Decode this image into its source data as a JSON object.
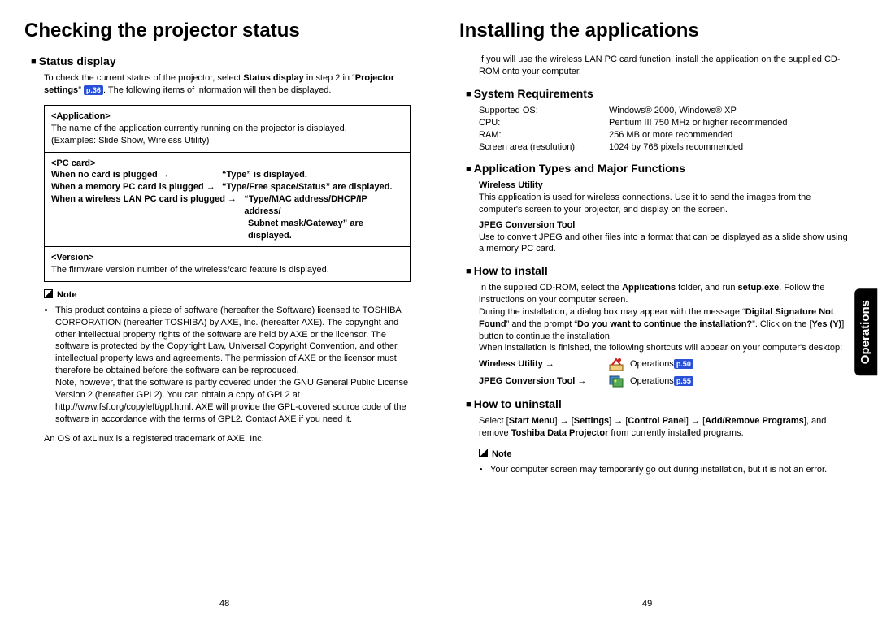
{
  "tab": "Operations",
  "pagenum_left": "48",
  "pagenum_right": "49",
  "left": {
    "h1": "Checking the projector status",
    "h2_status": "Status display",
    "status_intro_a": "To check the current status of the projector, select ",
    "status_intro_b": "Status display",
    "status_intro_c": " in step 2 in “",
    "status_intro_d": "Projector settings",
    "status_intro_e": "” ",
    "status_pref": "p.36",
    "status_intro_f": ". The following items of information will then be displayed.",
    "box_app_h": "<Application>",
    "box_app_1": "The name of the application currently running on the projector is displayed.",
    "box_app_2": "(Examples: Slide Show, Wireless Utility)",
    "box_pc_h": "<PC card>",
    "box_pc_r1a": "When no card is plugged →",
    "box_pc_r1b": "“Type” is displayed.",
    "box_pc_r2a": "When a memory PC card is plugged →",
    "box_pc_r2b": "“Type/Free space/Status” are displayed.",
    "box_pc_r3a": "When a wireless LAN PC card is plugged →",
    "box_pc_r3b": "“Type/MAC address/DHCP/IP address/",
    "box_pc_r3c": "Subnet mask/Gateway” are displayed.",
    "box_ver_h": "<Version>",
    "box_ver_1": "The firmware version number of the wireless/card feature is displayed.",
    "note_h": "Note",
    "note_li1": "This product contains a piece of software (hereafter the Software) licensed to TOSHIBA CORPORATION (hereafter TOSHIBA) by AXE, Inc. (hereafter AXE). The copyright and other intellectual property rights of the software are held by AXE or the licensor. The software is protected by the Copyright Law, Universal Copyright Convention, and other intellectual property laws and agreements. The permission of AXE or the licensor must therefore be obtained before the software can be reproduced.",
    "note_li1b": "Note, however, that the software is partly covered under the GNU General Public License Version 2 (hereafter GPL2). You can obtain a copy of GPL2 at http://www.fsf.org/copyleft/gpl.html. AXE will provide the GPL-covered source code of the software in accordance with the terms of GPL2. Contact AXE if you need it.",
    "note_foot": "An OS of axLinux is a registered trademark of AXE, Inc."
  },
  "right": {
    "h1": "Installing the applications",
    "intro": "If you will use the wireless LAN PC card function, install the application on the supplied CD-ROM onto your computer.",
    "h2_sys": "System Requirements",
    "sys_os_l": "Supported OS:",
    "sys_os_v": "Windows® 2000, Windows® XP",
    "sys_cpu_l": "CPU:",
    "sys_cpu_v": "Pentium III 750 MHz or higher recommended",
    "sys_ram_l": "RAM:",
    "sys_ram_v": "256 MB or more recommended",
    "sys_res_l": "Screen area (resolution):",
    "sys_res_v": "1024 by 768 pixels recommended",
    "h2_app": "Application Types and Major Functions",
    "app1_h": "Wireless Utility",
    "app1_b": "This application is used for wireless connections. Use it to send the images from the computer's screen to your projector, and display on the screen.",
    "app2_h": "JPEG Conversion Tool",
    "app2_b": "Use to convert JPEG and other files into a format that can be displayed as a slide show using a memory PC card.",
    "h2_install": "How to install",
    "inst_1a": "In the supplied CD-ROM, select the ",
    "inst_1b": "Applications",
    "inst_1c": " folder, and run ",
    "inst_1d": "setup.exe",
    "inst_1e": ". Follow the instructions on your computer screen.",
    "inst_2a": "During the installation, a dialog box may appear with the message “",
    "inst_2b": "Digital Signature Not Found",
    "inst_2c": "” and the prompt “",
    "inst_2d": "Do you want to continue the installation?",
    "inst_2e": "”. Click on the [",
    "inst_2f": "Yes (Y)",
    "inst_2g": "] button to continue the installation.",
    "inst_3": "When installation is finished, the following shortcuts will appear on your computer's desktop:",
    "sc1_l": "Wireless Utility →",
    "sc1_op": "Operations ",
    "sc1_p": "p.50",
    "sc2_l": "JPEG Conversion Tool →",
    "sc2_op": "Operations ",
    "sc2_p": "p.55",
    "h2_uninst": "How to uninstall",
    "un_a": "Select [",
    "un_b": "Start Menu",
    "un_c": "] → [",
    "un_d": "Settings",
    "un_e": "] → [",
    "un_f": "Control Panel",
    "un_g": "] → [",
    "un_h": "Add/Remove Programs",
    "un_i": "], and remove ",
    "un_j": "Toshiba Data Projector",
    "un_k": " from currently installed programs.",
    "note_h": "Note",
    "note_b": "Your computer screen may temporarily go out during installation, but it is not an error."
  }
}
